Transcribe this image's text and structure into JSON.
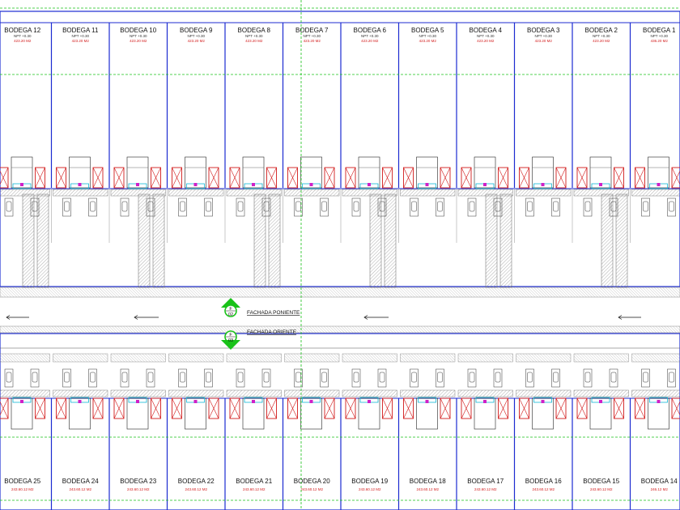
{
  "top_row": [
    {
      "name": "BODEGA 12",
      "npt": "NPT +0.30",
      "area": "423.20 M2"
    },
    {
      "name": "BODEGA 11",
      "npt": "NPT +0.30",
      "area": "423.20 M2"
    },
    {
      "name": "BODEGA 10",
      "npt": "NPT +0.30",
      "area": "423.20 M2"
    },
    {
      "name": "BODEGA 9",
      "npt": "NPT +0.30",
      "area": "423.20 M2"
    },
    {
      "name": "BODEGA 8",
      "npt": "NPT +0.30",
      "area": "423.20 M2"
    },
    {
      "name": "BODEGA 7",
      "npt": "NPT +0.30",
      "area": "423.20 M2"
    },
    {
      "name": "BODEGA 6",
      "npt": "NPT +0.30",
      "area": "423.20 M2"
    },
    {
      "name": "BODEGA 5",
      "npt": "NPT +0.30",
      "area": "423.20 M2"
    },
    {
      "name": "BODEGA 4",
      "npt": "NPT +0.30",
      "area": "423.20 M2"
    },
    {
      "name": "BODEGA 3",
      "npt": "NPT +0.30",
      "area": "423.20 M2"
    },
    {
      "name": "BODEGA 2",
      "npt": "NPT +0.30",
      "area": "423.20 M2"
    },
    {
      "name": "BODEGA 1",
      "npt": "NPT +0.30",
      "area": "436.20 M2"
    }
  ],
  "bottom_row": [
    {
      "name": "BODEGA 25",
      "area": "243.60.12 M2"
    },
    {
      "name": "BODEGA 24",
      "area": "243.60.12 M2"
    },
    {
      "name": "BODEGA 23",
      "area": "243.60.12 M2"
    },
    {
      "name": "BODEGA 22",
      "area": "243.60.12 M2"
    },
    {
      "name": "BODEGA 21",
      "area": "243.60.12 M2"
    },
    {
      "name": "BODEGA 20",
      "area": "243.60.12 M2"
    },
    {
      "name": "BODEGA 19",
      "area": "243.60.12 M2"
    },
    {
      "name": "BODEGA 18",
      "area": "243.60.12 M2"
    },
    {
      "name": "BODEGA 17",
      "area": "243.60.12 M2"
    },
    {
      "name": "BODEGA 16",
      "area": "243.60.12 M2"
    },
    {
      "name": "BODEGA 15",
      "area": "243.60.12 M2"
    },
    {
      "name": "BODEGA 14",
      "area": "246.12 M2"
    }
  ],
  "sections": [
    {
      "letter": "F",
      "number": "02",
      "title": "FACHADA PONIENTE",
      "direction": "up"
    },
    {
      "letter": "F",
      "number": "03",
      "title": "FACHADA ORIENTE",
      "direction": "down"
    }
  ],
  "colors": {
    "wall": "#1c2bd1",
    "guide": "#19c219",
    "accent": "#d21a1a",
    "cyan": "#10b7d6",
    "magenta": "#d01fc7",
    "hatch": "#9a9a9a"
  }
}
